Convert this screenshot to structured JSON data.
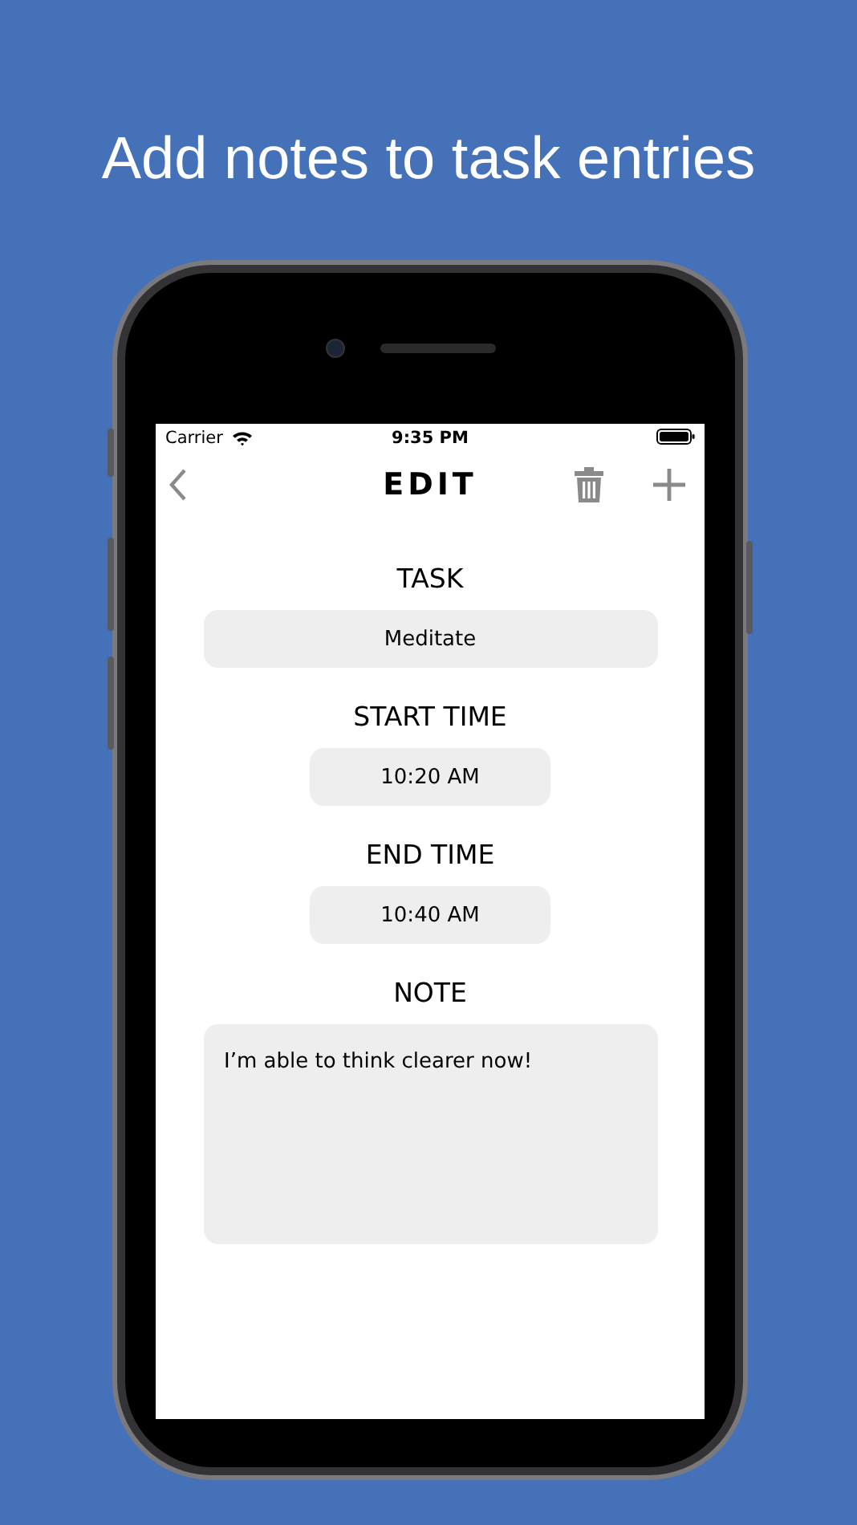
{
  "headline": "Add notes to task entries",
  "status_bar": {
    "carrier": "Carrier",
    "time": "9:35 PM"
  },
  "nav": {
    "title": "EDIT"
  },
  "fields": [
    {
      "kind": "wide",
      "label": "TASK",
      "value": "Meditate"
    },
    {
      "kind": "time",
      "label": "START TIME",
      "value": "10:20 AM"
    },
    {
      "kind": "time",
      "label": "END TIME",
      "value": "10:40 AM"
    },
    {
      "kind": "note",
      "label": "NOTE",
      "value": "I’m able to think clearer now!"
    }
  ]
}
